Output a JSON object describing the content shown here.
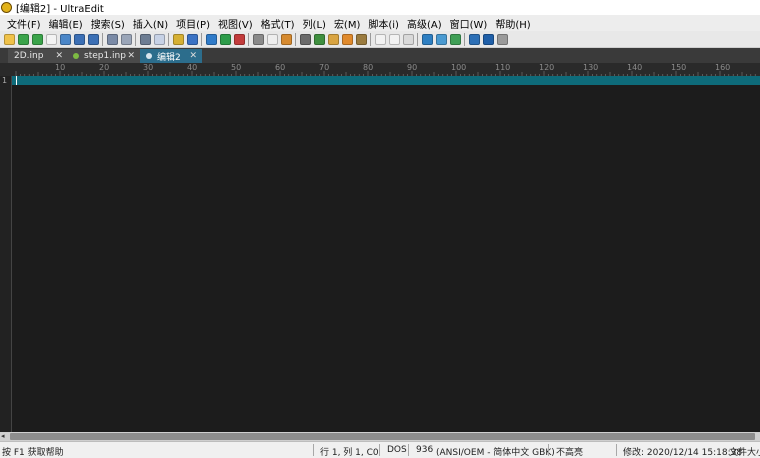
{
  "window": {
    "title": "[编辑2] - UltraEdit"
  },
  "menu": [
    "文件(F)",
    "编辑(E)",
    "搜索(S)",
    "插入(N)",
    "项目(P)",
    "视图(V)",
    "格式(T)",
    "列(L)",
    "宏(M)",
    "脚本(i)",
    "高级(A)",
    "窗口(W)",
    "帮助(H)"
  ],
  "toolbar_icons": [
    {
      "name": "new-file-icon",
      "color": "#f0c24a"
    },
    {
      "name": "back-icon",
      "color": "#3aa34a"
    },
    {
      "name": "forward-icon",
      "color": "#3aa34a"
    },
    {
      "name": "open-file-icon",
      "color": "#f3f3f3"
    },
    {
      "name": "open-folder-icon",
      "color": "#4a86c8"
    },
    {
      "name": "save-icon",
      "color": "#3b6fb5"
    },
    {
      "name": "save-all-icon",
      "color": "#3b6fb5"
    },
    {
      "name": "sep",
      "color": ""
    },
    {
      "name": "print-icon",
      "color": "#7a8aa6"
    },
    {
      "name": "print-preview-icon",
      "color": "#9aa5b8"
    },
    {
      "name": "sep",
      "color": ""
    },
    {
      "name": "calculator-icon",
      "color": "#6d7d93"
    },
    {
      "name": "properties-icon",
      "color": "#c7d2e6"
    },
    {
      "name": "sep",
      "color": ""
    },
    {
      "name": "columns-icon",
      "color": "#d6b033"
    },
    {
      "name": "hex-view-icon",
      "color": "#3a72c4"
    },
    {
      "name": "sep",
      "color": ""
    },
    {
      "name": "find-icon",
      "color": "#2f7bc9"
    },
    {
      "name": "find-next-icon",
      "color": "#2d9c4a"
    },
    {
      "name": "replace-icon",
      "color": "#c23b3b"
    },
    {
      "name": "sep",
      "color": ""
    },
    {
      "name": "cut-icon",
      "color": "#8a8a8a"
    },
    {
      "name": "copy-icon",
      "color": "#eeeeee"
    },
    {
      "name": "paste-icon",
      "color": "#d68a2f"
    },
    {
      "name": "sep",
      "color": ""
    },
    {
      "name": "binoculars-icon",
      "color": "#6b6b6b"
    },
    {
      "name": "find-in-files-icon",
      "color": "#3f8f3f"
    },
    {
      "name": "macro-record-icon",
      "color": "#d9a441"
    },
    {
      "name": "macro-play-icon",
      "color": "#e08a2c"
    },
    {
      "name": "macro-icon",
      "color": "#9a7b3f"
    },
    {
      "name": "sep",
      "color": ""
    },
    {
      "name": "window-icon",
      "color": "#f2f2f2"
    },
    {
      "name": "tile-icon",
      "color": "#f2f2f2"
    },
    {
      "name": "cascade-icon",
      "color": "#d9d9d9"
    },
    {
      "name": "sep",
      "color": ""
    },
    {
      "name": "browser-icon",
      "color": "#2e7fc2"
    },
    {
      "name": "ftp-icon",
      "color": "#4a9ad1"
    },
    {
      "name": "sync-icon",
      "color": "#3f9f56"
    },
    {
      "name": "sep",
      "color": ""
    },
    {
      "name": "layout-icon",
      "color": "#2c6fb6"
    },
    {
      "name": "help-icon",
      "color": "#1f5fa8"
    },
    {
      "name": "toolbar-more-icon",
      "color": "#9a9a9a"
    }
  ],
  "tabs": [
    {
      "label": "2D.inp",
      "close": "✕",
      "active": false,
      "dot": ""
    },
    {
      "label": "step1.inp",
      "close": "✕",
      "active": false,
      "dot": "#7dbb43"
    },
    {
      "label": "编辑2",
      "close": "✕",
      "active": true,
      "dot": "#d8e6ef"
    }
  ],
  "ruler": {
    "labels": [
      "10",
      "20",
      "30",
      "40",
      "50",
      "60",
      "70",
      "80",
      "90",
      "100",
      "110",
      "120",
      "130",
      "140",
      "150",
      "160"
    ]
  },
  "editor": {
    "line_numbers": [
      "1"
    ],
    "content": ""
  },
  "scrollbar": {
    "left_arrow": "◂"
  },
  "status": {
    "help": "按 F1 获取帮助",
    "position": "行 1, 列 1, C0",
    "line_ending": "DOS",
    "codepage": "936",
    "encoding": "(ANSI/OEM - 简体中文 GBK)",
    "highlight": "不高亮",
    "modified": "修改:  2020/12/14 15:18:38",
    "filesize": "文件大小"
  },
  "colors": {
    "editor_bg": "#1c1c1c",
    "active_tab": "#2c6d8c",
    "current_line": "#0e6b7a"
  }
}
